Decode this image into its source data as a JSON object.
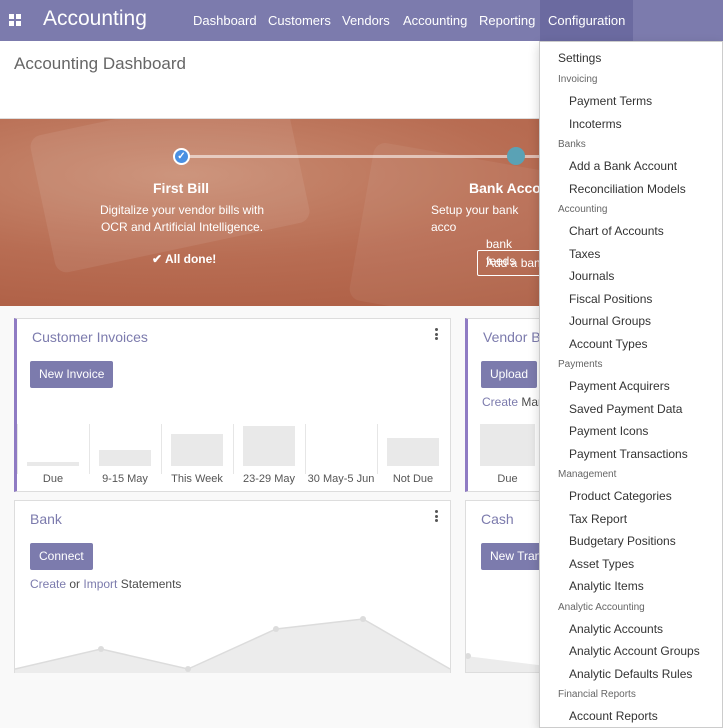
{
  "topbar": {
    "brand": "Accounting",
    "menu": [
      "Dashboard",
      "Customers",
      "Vendors",
      "Accounting",
      "Reporting",
      "Configuration"
    ]
  },
  "page": {
    "title": "Accounting Dashboard"
  },
  "banner": {
    "step1": {
      "title": "First Bill",
      "desc_line1": "Digitalize your vendor bills with",
      "desc_line2": "OCR and Artificial Intelligence.",
      "done": "All done!"
    },
    "step2": {
      "title": "Bank Acco",
      "desc_line1": "Setup your bank acco",
      "desc_line2": "bank feeds",
      "button": "Add a ban"
    }
  },
  "customer_invoices": {
    "title": "Customer Invoices",
    "button": "New Invoice",
    "bars": [
      {
        "label": "Due",
        "value": 0.1
      },
      {
        "label": "9-15 May",
        "value": 0.4
      },
      {
        "label": "This Week",
        "value": 0.8
      },
      {
        "label": "23-29 May",
        "value": 1.0
      },
      {
        "label": "30 May-5 Jun",
        "value": 0
      },
      {
        "label": "Not Due",
        "value": 0.7
      }
    ]
  },
  "vendor_bills": {
    "title": "Vendor B",
    "button": "Upload",
    "create": "Create",
    "manually": " Mar",
    "bar_label": "Due"
  },
  "bank": {
    "title": "Bank",
    "button": "Connect",
    "create": "Create",
    "or": " or ",
    "import": "Import",
    "statements": " Statements"
  },
  "cash": {
    "title": "Cash",
    "button": "New Tran"
  },
  "dropdown": {
    "settings": "Settings",
    "sections": [
      {
        "header": "Invoicing",
        "items": [
          "Payment Terms",
          "Incoterms"
        ]
      },
      {
        "header": "Banks",
        "items": [
          "Add a Bank Account",
          "Reconciliation Models"
        ]
      },
      {
        "header": "Accounting",
        "items": [
          "Chart of Accounts",
          "Taxes",
          "Journals",
          "Fiscal Positions",
          "Journal Groups",
          "Account Types"
        ]
      },
      {
        "header": "Payments",
        "items": [
          "Payment Acquirers",
          "Saved Payment Data",
          "Payment Icons",
          "Payment Transactions"
        ]
      },
      {
        "header": "Management",
        "items": [
          "Product Categories",
          "Tax Report",
          "Budgetary Positions",
          "Asset Types",
          "Analytic Items"
        ]
      },
      {
        "header": "Analytic Accounting",
        "items": [
          "Analytic Accounts",
          "Analytic Account Groups",
          "Analytic Defaults Rules"
        ]
      },
      {
        "header": "Financial Reports",
        "items": [
          "Account Reports"
        ]
      }
    ]
  },
  "colors": {
    "brand": "#7c7bad",
    "banner": "#b86d53",
    "done_dot": "#4a90e2"
  }
}
